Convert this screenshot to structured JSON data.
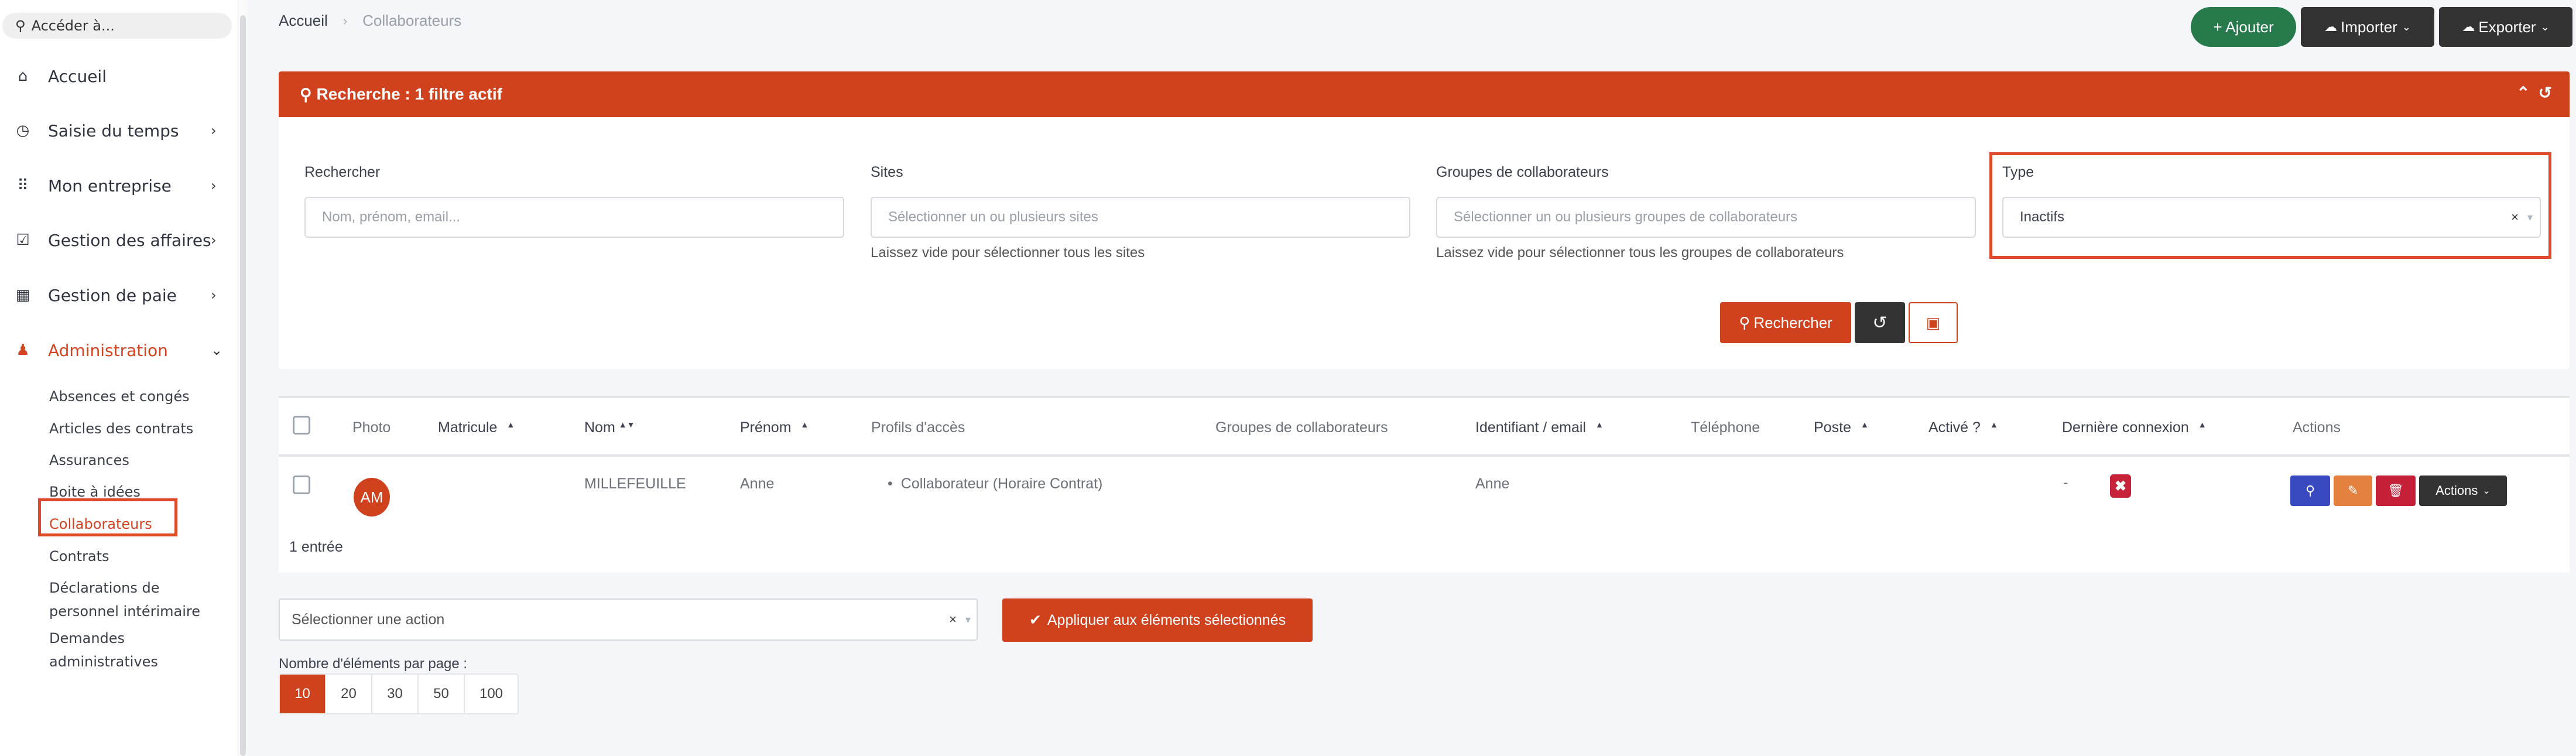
{
  "sidebar": {
    "search_placeholder": "Accéder à...",
    "items": [
      {
        "label": "Accueil",
        "icon": "home-icon",
        "has_children": false
      },
      {
        "label": "Saisie du temps",
        "icon": "clock-icon",
        "has_children": true
      },
      {
        "label": "Mon entreprise",
        "icon": "grid-dots-icon",
        "has_children": true
      },
      {
        "label": "Gestion des affaires",
        "icon": "clipboard-check-icon",
        "has_children": true
      },
      {
        "label": "Gestion de paie",
        "icon": "calculator-icon",
        "has_children": true
      },
      {
        "label": "Administration",
        "icon": "user-tie-icon",
        "has_children": true,
        "expanded": true,
        "active": true
      }
    ],
    "sub_items": [
      "Absences et congés",
      "Articles des contrats",
      "Assurances",
      "Boite à idées",
      "Collaborateurs",
      "Contrats",
      "Déclarations de personnel intérimaire",
      "Demandes administratives"
    ],
    "active_sub_item": "Collaborateurs"
  },
  "breadcrumb": {
    "home": "Accueil",
    "separator": "›",
    "current": "Collaborateurs"
  },
  "toolbar": {
    "add_label": "+ Ajouter",
    "import_label": "Importer",
    "export_label": "Exporter"
  },
  "search": {
    "title": "Recherche : 1 filtre actif",
    "fields": {
      "query": {
        "label": "Rechercher",
        "placeholder": "Nom, prénom, email...",
        "value": ""
      },
      "sites": {
        "label": "Sites",
        "placeholder": "Sélectionner un ou plusieurs sites",
        "help": "Laissez vide pour sélectionner tous les sites"
      },
      "groups": {
        "label": "Groupes de collaborateurs",
        "placeholder": "Sélectionner un ou plusieurs groupes de collaborateurs",
        "help": "Laissez vide pour sélectionner tous les groupes de collaborateurs"
      },
      "type": {
        "label": "Type",
        "value": "Inactifs",
        "clear": "×",
        "arrow": "▾"
      }
    },
    "search_button": "Rechercher"
  },
  "table": {
    "columns": [
      {
        "key": "photo",
        "label": "Photo",
        "sortable": false
      },
      {
        "key": "matricule",
        "label": "Matricule",
        "sortable": true
      },
      {
        "key": "nom",
        "label": "Nom",
        "sortable": true,
        "sorted": "asc"
      },
      {
        "key": "prenom",
        "label": "Prénom",
        "sortable": true
      },
      {
        "key": "profils",
        "label": "Profils d'accès",
        "sortable": false
      },
      {
        "key": "groupes",
        "label": "Groupes de collaborateurs",
        "sortable": false
      },
      {
        "key": "identifiant",
        "label": "Identifiant / email",
        "sortable": true
      },
      {
        "key": "telephone",
        "label": "Téléphone",
        "sortable": false
      },
      {
        "key": "poste",
        "label": "Poste",
        "sortable": true
      },
      {
        "key": "active",
        "label": "Activé ?",
        "sortable": true
      },
      {
        "key": "last_login",
        "label": "Dernière connexion",
        "sortable": true
      },
      {
        "key": "actions",
        "label": "Actions",
        "sortable": false
      }
    ],
    "rows": [
      {
        "initials": "AM",
        "matricule": "",
        "nom": "MILLEFEUILLE",
        "prenom": "Anne",
        "profils": [
          "Collaborateur (Horaire Contrat)"
        ],
        "groupes": "",
        "identifiant": "Anne",
        "telephone": "",
        "poste": "",
        "active": false,
        "last_login": "-",
        "actions_label": "Actions"
      }
    ],
    "entries_count": "1 entrée"
  },
  "bulk": {
    "placeholder": "Sélectionner une action",
    "apply_label": "Appliquer aux éléments sélectionnés"
  },
  "pagination": {
    "label": "Nombre d'éléments par page :",
    "options": [
      "10",
      "20",
      "30",
      "50",
      "100"
    ],
    "selected": "10"
  },
  "colors": {
    "brand": "#d0411e",
    "success": "#277a4c",
    "dark": "#333333",
    "view": "#3949c0",
    "edit": "#e5813f",
    "danger": "#c62039",
    "highlight": "#e04a2a"
  }
}
